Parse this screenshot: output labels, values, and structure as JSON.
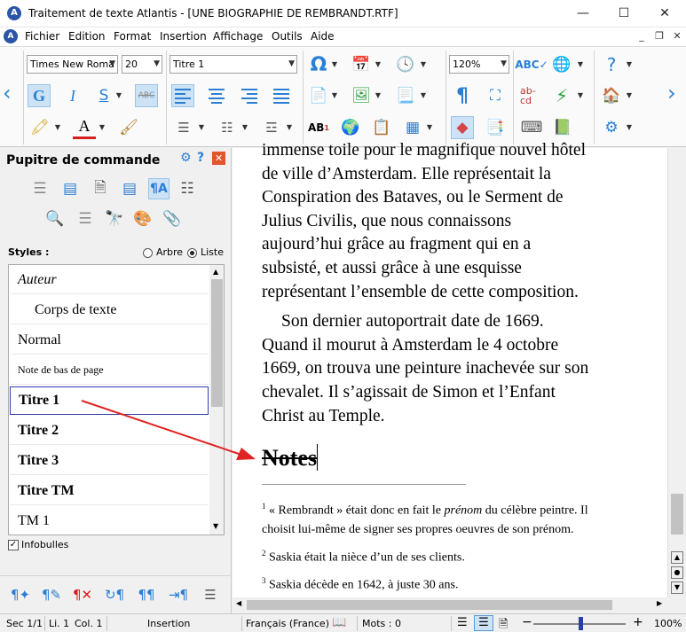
{
  "window": {
    "title": "Traitement de texte Atlantis - [UNE BIOGRAPHIE DE REMBRANDT.RTF]",
    "minimize": "—",
    "maximize": "☐",
    "close": "✕"
  },
  "menu": {
    "items": [
      "Fichier",
      "Edition",
      "Format",
      "Insertion",
      "Affichage",
      "Outils",
      "Aide"
    ]
  },
  "toolbar": {
    "font_name": "Times New Roma",
    "font_size": "20",
    "style": "Titre 1",
    "zoom": "120%",
    "bold": "G",
    "italic": "I",
    "underline": "S",
    "strike": "ABC"
  },
  "panel": {
    "title": "Pupitre de commande",
    "styles_label": "Styles :",
    "radio_tree": "Arbre",
    "radio_list": "Liste",
    "styles": [
      "Auteur",
      "Corps de texte",
      "Normal",
      "Note de bas de page",
      "Titre 1",
      "Titre 2",
      "Titre 3",
      "Titre TM",
      "TM 1"
    ],
    "tooltips_label": "Infobulles"
  },
  "document": {
    "para1_lines": [
      "immense toile pour le magnifique nouvel hôtel",
      "de ville d’Amsterdam. Elle représentait la",
      "Conspiration des Bataves, ou le Serment de",
      "Julius Civilis, que nous connaissons",
      "aujourd’hui grâce au fragment qui en a",
      "subsisté, et aussi grâce à une esquisse",
      "représentant l’ensemble de cette composition."
    ],
    "para2_lines": [
      "Son dernier autoportrait date de 1669.",
      "Quand il mourut à Amsterdam le 4 octobre",
      "1669, on trouva une peinture inachevée sur son",
      "chevalet. Il s’agissait de Simon et l’Enfant",
      "Christ au Temple."
    ],
    "heading": "Notes",
    "footnotes": [
      {
        "num": "1",
        "before": "« Rembrandt » était donc en fait le ",
        "em": "prénom",
        "after": " du célèbre peintre. Il",
        "line2": "choisit lui-même de signer ses propres oeuvres de son prénom."
      },
      {
        "num": "2",
        "text": "Saskia était la nièce d’un de ses clients."
      },
      {
        "num": "3",
        "text": "Saskia décède en 1642, à juste 30 ans."
      }
    ]
  },
  "status": {
    "section": "Sec 1/1",
    "line": "Li. 1",
    "col": "Col. 1",
    "mode": "Insertion",
    "language": "Français (France)",
    "words": "Mots : 0",
    "zoom": "100%",
    "zoom_minus": "−",
    "zoom_plus": "+"
  },
  "colors": {
    "accent": "#2a7fd4",
    "arrow": "#e02424",
    "selected_border": "#2b3fa8"
  }
}
